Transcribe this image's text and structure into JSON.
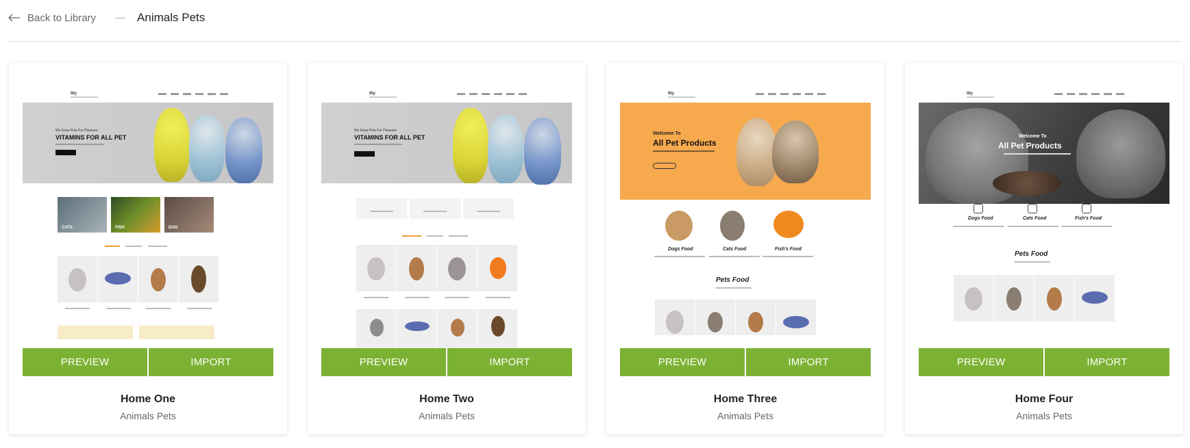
{
  "header": {
    "back_label": "Back to Library",
    "title": "Animals Pets"
  },
  "cards": [
    {
      "title": "Home One",
      "subtitle": "Animals Pets",
      "preview_label": "PREVIEW",
      "import_label": "IMPORT"
    },
    {
      "title": "Home Two",
      "subtitle": "Animals Pets",
      "preview_label": "PREVIEW",
      "import_label": "IMPORT"
    },
    {
      "title": "Home Three",
      "subtitle": "Animals Pets",
      "preview_label": "PREVIEW",
      "import_label": "IMPORT"
    },
    {
      "title": "Home Four",
      "subtitle": "Animals Pets",
      "preview_label": "PREVIEW",
      "import_label": "IMPORT"
    }
  ],
  "previews": {
    "p1": {
      "logo": "Itty",
      "hero_small": "We Keep Pets For Pleasure",
      "hero_big": "VITAMINS FOR ALL PET",
      "cats": "CATS",
      "fish": "FISH",
      "dog": "DOG"
    },
    "p2": {
      "logo": "Itty",
      "hero_small": "We Keep Pets For Pleasure",
      "hero_big": "VITAMINS FOR ALL PET"
    },
    "p3": {
      "logo": "Itty",
      "hero_small": "Welcome To",
      "hero_big": "All Pet Products",
      "dogs": "Dogs Food",
      "cats": "Cats Food",
      "fish": "Fish's Food",
      "section": "Pets Food"
    },
    "p4": {
      "logo": "Itty",
      "hero_small": "Welcome To",
      "hero_big": "All Pet Products",
      "dogs": "Dogs Food",
      "cats": "Cats Food",
      "fish": "Fish's Food",
      "section": "Pets Food"
    }
  },
  "colors": {
    "accent_green": "#7cb233",
    "orange_hero": "#f7a94e"
  }
}
